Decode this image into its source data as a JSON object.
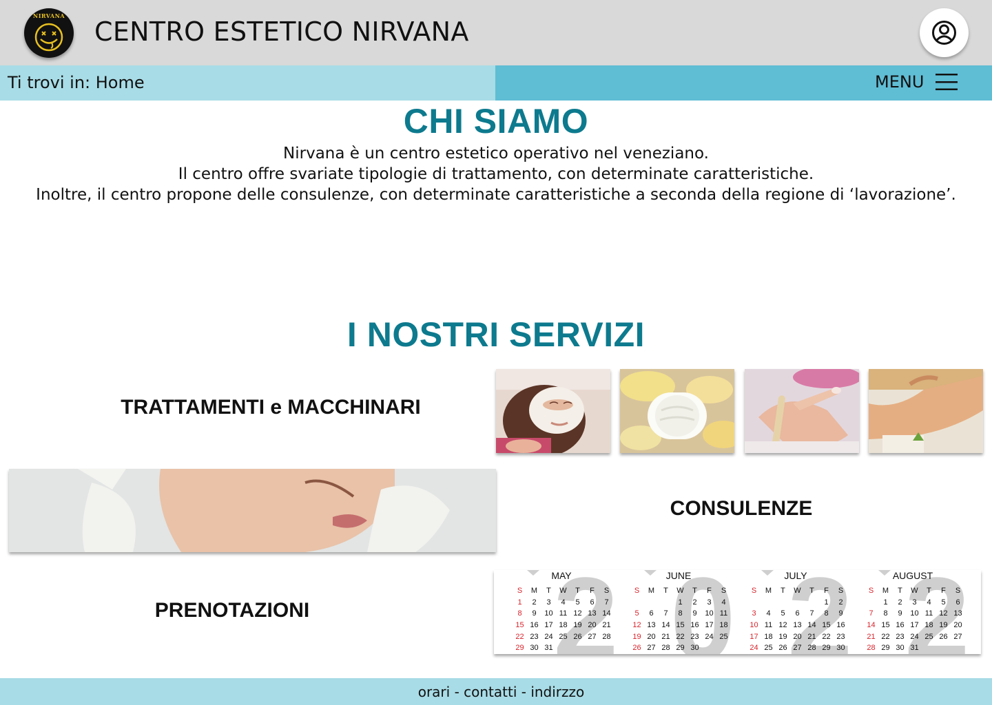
{
  "header": {
    "logo_text": "NIRVANA",
    "title": "CENTRO ESTETICO NIRVANA",
    "user_icon": "account-circle-icon"
  },
  "nav": {
    "breadcrumb": "Ti trovi in: Home",
    "menu_label": "MENU",
    "menu_icon": "hamburger-icon"
  },
  "about": {
    "heading": "CHI SIAMO",
    "lines": [
      "Nirvana è un centro estetico operativo nel veneziano.",
      "Il centro offre svariate tipologie di trattamento, con determinate caratteristiche.",
      "Inoltre, il centro propone delle consulenze, con determinate caratteristiche a seconda della regione di ‘lavorazione’."
    ]
  },
  "services": {
    "heading": "I NOSTRI SERVIZI",
    "trattamenti_label": "TRATTAMENTI e MACCHINARI",
    "consulenze_label": "CONSULENZE",
    "prenotazioni_label": "PRENOTAZIONI"
  },
  "calendar": {
    "weekday_header": [
      "S",
      "M",
      "T",
      "W",
      "T",
      "F",
      "S"
    ],
    "months": [
      {
        "name": "MAY",
        "start": 0,
        "days": 31
      },
      {
        "name": "JUNE",
        "start": 3,
        "days": 30
      },
      {
        "name": "JULY",
        "start": 5,
        "days": 31
      },
      {
        "name": "AUGUST",
        "start": 1,
        "days": 31
      }
    ]
  },
  "footer": {
    "text": "orari - contatti - indirzzo"
  },
  "colors": {
    "header_bg": "#d9d9d9",
    "breadcrumb_bg": "#a8dce6",
    "menu_bg": "#5fbdd4",
    "heading": "#0d7a8e",
    "footer_bg": "#a8dce6",
    "sunday": "#d8242c"
  }
}
